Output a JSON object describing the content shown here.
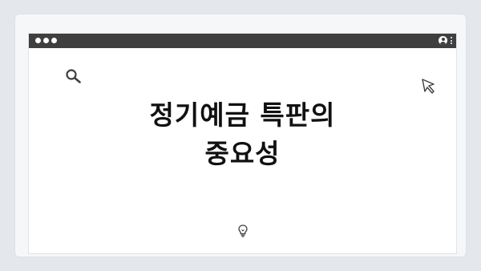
{
  "content": {
    "title_line_1": "정기예금 특판의",
    "title_line_2": "중요성"
  },
  "icons": {
    "carousel": "carousel-dots",
    "window": "window-control-dots",
    "profile": "profile-icon",
    "menu": "kebab-menu-icon",
    "search": "magnifier-icon",
    "cursor": "arrow-cursor-icon",
    "idea": "lightbulb-icon"
  },
  "colors": {
    "background": "#e4e8ed",
    "titlebar": "#3f3f40",
    "window_body": "#ffffff",
    "title_text": "#111111",
    "icon_stroke": "#3f3f40"
  }
}
